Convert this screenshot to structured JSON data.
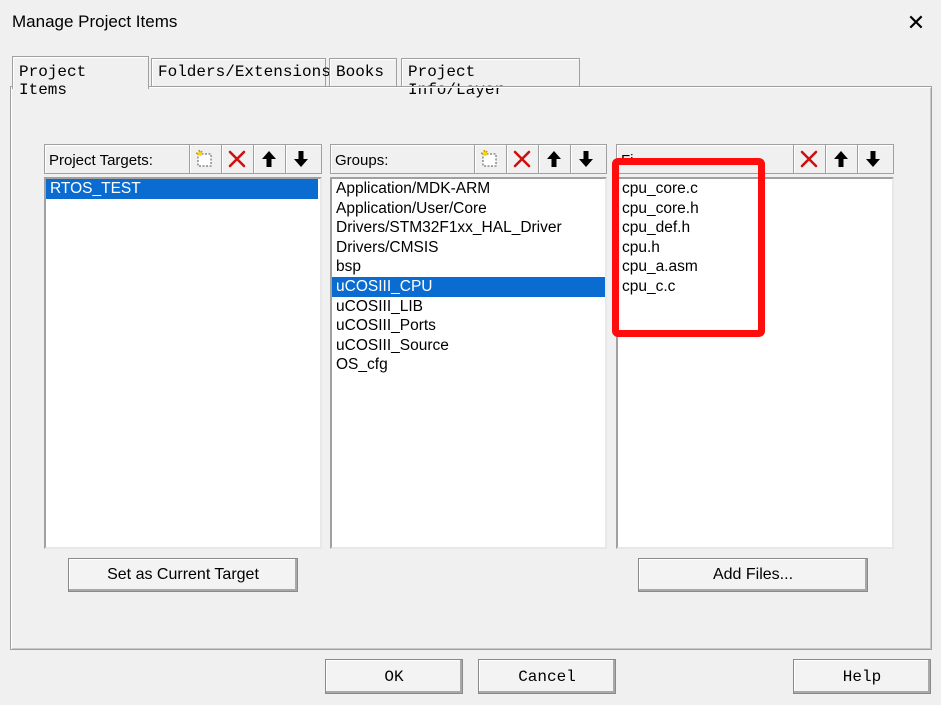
{
  "window": {
    "title": "Manage Project Items",
    "close_glyph": "✕"
  },
  "tabs": [
    {
      "label": "Project Items",
      "active": true
    },
    {
      "label": "Folders/Extensions",
      "active": false
    },
    {
      "label": "Books",
      "active": false
    },
    {
      "label": "Project Info/Layer",
      "active": false
    }
  ],
  "targets": {
    "header": "Project Targets:",
    "items": [
      "RTOS_TEST"
    ],
    "selected": "RTOS_TEST"
  },
  "groups": {
    "header": "Groups:",
    "items": [
      "Application/MDK-ARM",
      "Application/User/Core",
      "Drivers/STM32F1xx_HAL_Driver",
      "Drivers/CMSIS",
      "bsp",
      "uCOSIII_CPU",
      "uCOSIII_LIB",
      "uCOSIII_Ports",
      "uCOSIII_Source",
      "OS_cfg"
    ],
    "selected": "uCOSIII_CPU"
  },
  "files": {
    "header": "Fi",
    "items": [
      "cpu_core.c",
      "cpu_core.h",
      "cpu_def.h",
      "cpu.h",
      "cpu_a.asm",
      "cpu_c.c"
    ]
  },
  "buttons": {
    "set_current_target": "Set as Current Target",
    "add_files": "Add Files...",
    "ok": "OK",
    "cancel": "Cancel",
    "help": "Help"
  },
  "colors": {
    "selection": "#0a6cd0",
    "highlight_box": "#ff0d0d",
    "delete_icon": "#d01010"
  },
  "icons": [
    "new-item-icon",
    "delete-icon",
    "move-up-icon",
    "move-down-icon"
  ]
}
